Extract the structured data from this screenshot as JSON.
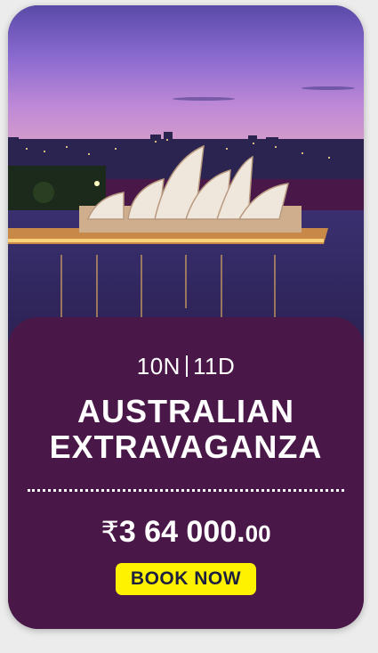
{
  "card": {
    "duration_nights": "10N",
    "duration_days": "11D",
    "title_line1": "AUSTRALIAN",
    "title_line2": "EXTRAVAGANZA",
    "price_currency": "₹",
    "price_main": "3 64 000.",
    "price_decimals": "00",
    "book_label": "BOOK NOW"
  },
  "colors": {
    "panel": "#4a1848",
    "button": "#fff200",
    "button_text": "#1d1f3e",
    "page_bg": "#ececec"
  }
}
